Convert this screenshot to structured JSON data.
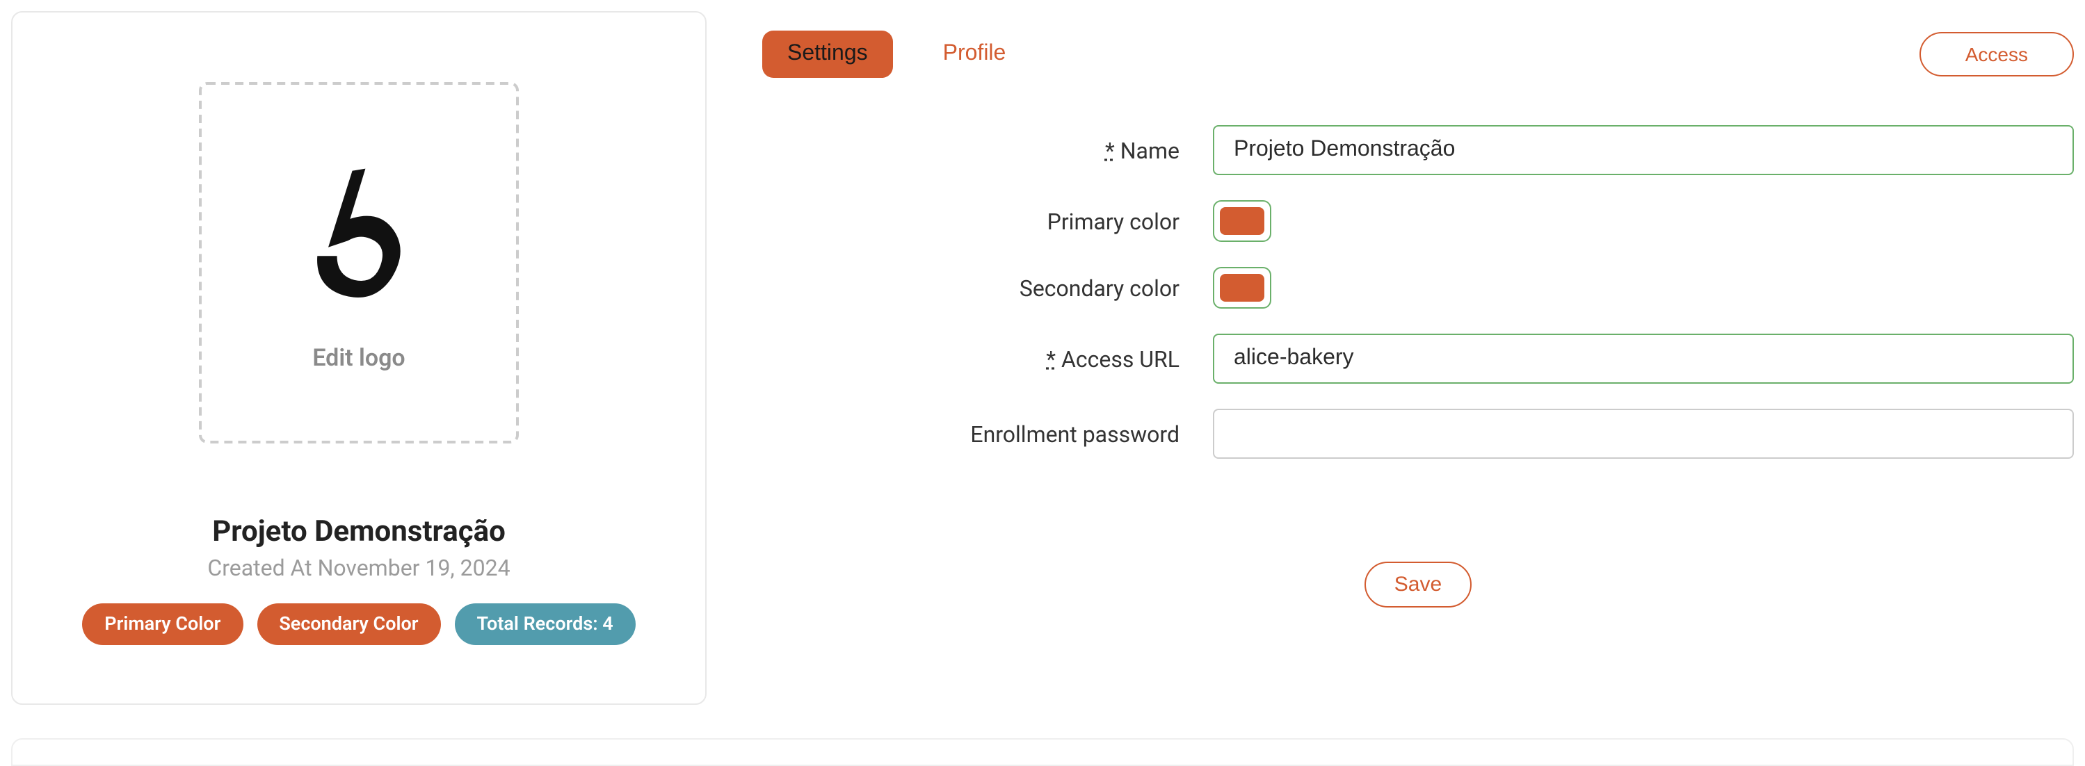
{
  "card": {
    "edit_logo_label": "Edit logo",
    "title": "Projeto Demonstração",
    "subtitle": "Created At November 19, 2024",
    "badges": {
      "primary": "Primary Color",
      "secondary": "Secondary Color",
      "records": "Total Records: 4"
    }
  },
  "tabs": {
    "settings": "Settings",
    "profile": "Profile"
  },
  "buttons": {
    "access": "Access",
    "save": "Save"
  },
  "form": {
    "required_mark": "*",
    "name": {
      "label": "Name",
      "value": "Projeto Demonstração"
    },
    "primary_color": {
      "label": "Primary color",
      "value": "#d35c30"
    },
    "secondary_color": {
      "label": "Secondary color",
      "value": "#d35c30"
    },
    "access_url": {
      "label": "Access URL",
      "value": "alice-bakery"
    },
    "enrollment_password": {
      "label": "Enrollment password",
      "value": ""
    }
  }
}
